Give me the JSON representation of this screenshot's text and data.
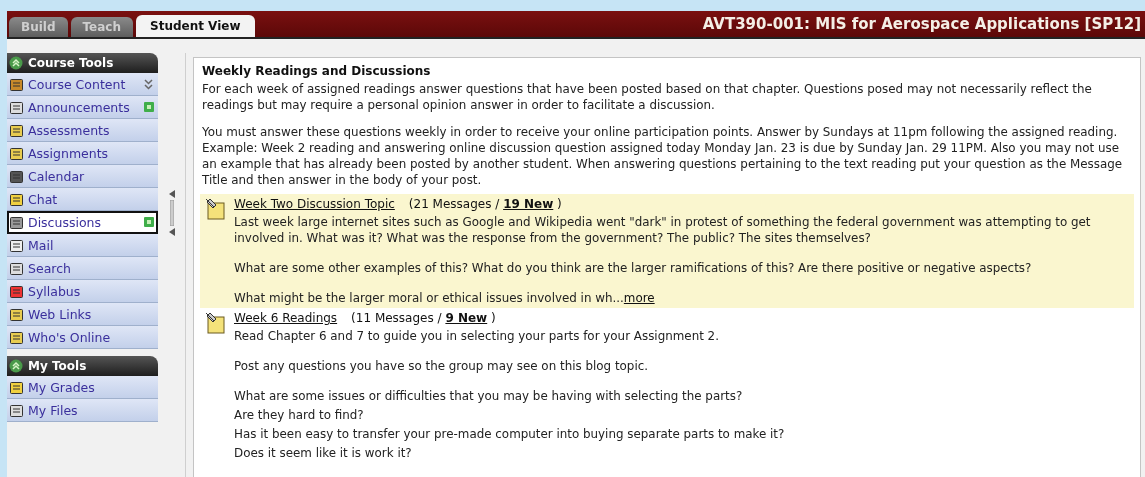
{
  "tabs": [
    {
      "label": "Build",
      "selected": false
    },
    {
      "label": "Teach",
      "selected": false
    },
    {
      "label": "Student View",
      "selected": true
    }
  ],
  "course_title": "AVT390-001: MIS for Aerospace Applications [SP12]",
  "sidebar": [
    {
      "title": "Course Tools",
      "items": [
        {
          "label": "Course Content",
          "selected": false,
          "new": false,
          "expandable": true
        },
        {
          "label": "Announcements",
          "selected": false,
          "new": true,
          "expandable": false
        },
        {
          "label": "Assessments",
          "selected": false,
          "new": false,
          "expandable": false
        },
        {
          "label": "Assignments",
          "selected": false,
          "new": false,
          "expandable": false
        },
        {
          "label": "Calendar",
          "selected": false,
          "new": false,
          "expandable": false
        },
        {
          "label": "Chat",
          "selected": false,
          "new": false,
          "expandable": false
        },
        {
          "label": "Discussions",
          "selected": true,
          "new": true,
          "expandable": false
        },
        {
          "label": "Mail",
          "selected": false,
          "new": false,
          "expandable": false
        },
        {
          "label": "Search",
          "selected": false,
          "new": false,
          "expandable": false
        },
        {
          "label": "Syllabus",
          "selected": false,
          "new": false,
          "expandable": false
        },
        {
          "label": "Web Links",
          "selected": false,
          "new": false,
          "expandable": false
        },
        {
          "label": "Who's Online",
          "selected": false,
          "new": false,
          "expandable": false
        }
      ]
    },
    {
      "title": "My Tools",
      "items": [
        {
          "label": "My Grades",
          "selected": false,
          "new": false,
          "expandable": false
        },
        {
          "label": "My Files",
          "selected": false,
          "new": false,
          "expandable": false
        }
      ]
    }
  ],
  "panel": {
    "title": "Weekly Readings and Discussions",
    "paragraphs": [
      "For each week of assigned readings answer questions that have been posted based on that chapter. Questions posed may not necessarily reflect the readings but may require a personal opinion answer in order to facilitate a discussion.",
      "You must answer these questions weekly in order to receive your online participation points. Answer by Sundays at 11pm following the assigned reading. Example: Week 2 reading and answering online discussion question assigned today Monday Jan. 23 is due by Sunday Jan. 29 11PM. Also you may not use an example that has already been posted by another student. When answering questions pertaining to the text reading put your question as the Message Title and then answer in the body of your post."
    ],
    "topics": [
      {
        "title": "Week Two Discussion Topic",
        "count": "(21 Messages /",
        "new": "19 New",
        "close": ")",
        "highlighted": true,
        "paragraphs": [
          [
            "Last week large internet sites such as Google and Wikipedia went \"dark\" in protest of something the federal government was attempting to get involved in. What was it? What was the response from the government? The public? The sites themselves?"
          ],
          [
            "What are some other examples of this? What do you think are the larger ramifications of this? Are there positive or negative aspects?"
          ],
          [
            "What might be the larger moral or ethical issues involved in wh..."
          ]
        ],
        "more": "more"
      },
      {
        "title": "Week 6 Readings",
        "count": "(11 Messages /",
        "new": "9 New",
        "close": ")",
        "highlighted": false,
        "paragraphs": [
          [
            "Read Chapter 6 and 7 to guide you in selecting your parts for your Assignment 2."
          ],
          [
            "Post any questions you have so the group may see on this blog topic."
          ],
          [
            "What are some issues or difficulties that you may be having with selecting the parts?",
            "Are they hard to find?",
            "Has it been easy to transfer your pre-made computer into buying separate parts to make it?",
            "Does it seem like it is work it?"
          ]
        ]
      }
    ]
  }
}
